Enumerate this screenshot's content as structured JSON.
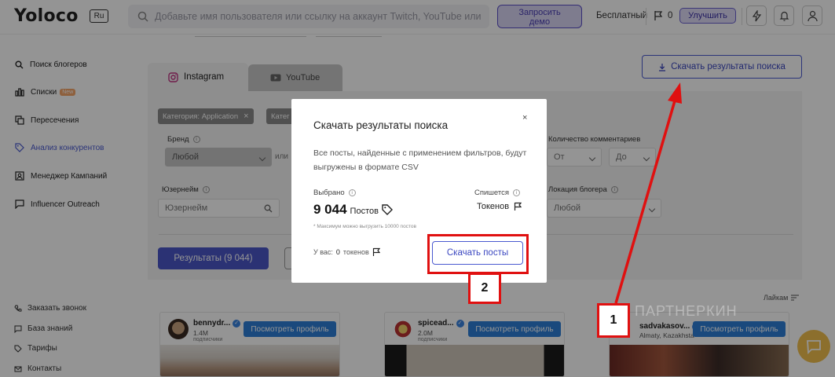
{
  "header": {
    "logo": "Yoloco",
    "lang": "Ru",
    "search_placeholder": "Добавьте имя пользователя или ссылку на аккаунт Twitch, YouTube или Instagram",
    "demo_label_1": "Запросить",
    "demo_label_2": "демо",
    "plan": "Бесплатный",
    "token_count": "0",
    "upgrade": "Улучшить"
  },
  "sidebar": {
    "items": [
      {
        "label": "Поиск блогеров",
        "icon": "search-icon"
      },
      {
        "label": "Списки",
        "icon": "lists-icon",
        "badge": "New"
      },
      {
        "label": "Пересечения",
        "icon": "intersections-icon"
      },
      {
        "label": "Анализ конкурентов",
        "icon": "tag-icon"
      },
      {
        "label": "Менеджер Кампаний",
        "icon": "person-icon"
      },
      {
        "label": "Influencer Outreach",
        "icon": "chat-icon"
      }
    ],
    "bottom": [
      {
        "label": "Заказать звонок",
        "icon": "phone-icon"
      },
      {
        "label": "База знаний",
        "icon": "book-icon"
      },
      {
        "label": "Тарифы",
        "icon": "tag-icon"
      },
      {
        "label": "Контакты",
        "icon": "mail-icon"
      }
    ]
  },
  "tabs": {
    "instagram": "Instagram",
    "youtube": "YouTube"
  },
  "download_results": "Скачать результаты поиска",
  "filters": {
    "chips": [
      "Категория: Application",
      "Катег"
    ],
    "brand_label": "Бренд",
    "brand_value": "Любой",
    "or": "или",
    "username_label": "Юзернейм",
    "username_placeholder": "Юзернейм",
    "comments_label": "Количество комментариев",
    "from": "От",
    "to": "До",
    "location_label": "Локация блогера",
    "location_value": "Любой"
  },
  "results_button": "Результаты (9 044)",
  "sort_label": "Лайкам",
  "cards": [
    {
      "name": "bennydr...",
      "subs": "1.4M",
      "subs_label": "подписчики",
      "button": "Посмотреть профиль"
    },
    {
      "name": "spicead...",
      "subs": "2.0M",
      "subs_label": "подписчики",
      "button": "Посмотреть профиль"
    },
    {
      "name": "sadvakasov...",
      "subs": "Almaty, Kazakhsta",
      "subs_label": "",
      "button": "Посмотреть профиль"
    }
  ],
  "modal": {
    "title": "Скачать результаты поиска",
    "close": "×",
    "desc": "Все посты, найденные с применением фильтров, будут выгружены в формате CSV",
    "selected_label": "Выбрано",
    "selected_value": "9 044",
    "selected_unit": "Постов",
    "charge_label": "Спишется",
    "charge_value": "Токенов",
    "note": "* Максимум можно выгрузить 10000 постов",
    "have_label": "У вас:",
    "have_value": "0",
    "have_unit": "токенов",
    "download_posts": "Скачать посты"
  },
  "annotations": {
    "num1": "1",
    "num2": "2"
  },
  "watermark": "ПАРТНЕРКИН",
  "colors": {
    "accent": "#4b57c8",
    "annotation": "#e01010",
    "view_btn": "#2d7fd8"
  }
}
